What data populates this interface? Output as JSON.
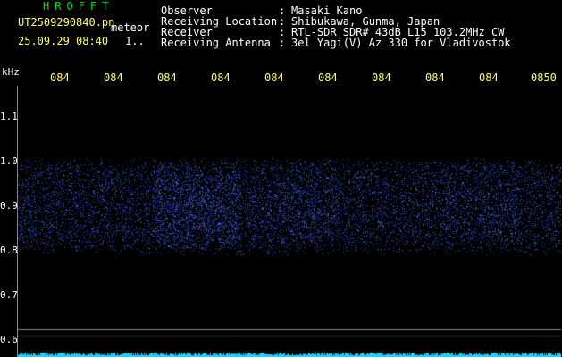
{
  "header": {
    "brand": "HROFFT",
    "filename": "UT2509290840.pn",
    "mode": "meteor",
    "datetime": "25.09.29 08:40",
    "count": "1..",
    "info": [
      {
        "label": "Observer",
        "value": "Masaki Kano"
      },
      {
        "label": "Receiving Location",
        "value": "Shibukawa, Gunma, Japan"
      },
      {
        "label": "Receiver",
        "value": "RTL-SDR SDR# 43dB L15 103.2MHz CW"
      },
      {
        "label": "Receiving Antenna",
        "value": "3el Yagi(V) Az 330 for Vladivostok"
      }
    ]
  },
  "axes": {
    "y_unit": "kHz",
    "y_ticks": [
      "1.1",
      "1.0",
      "0.9",
      "0.8",
      "0.7",
      "0.6"
    ],
    "x_ticks": [
      "084",
      "084",
      "084",
      "084",
      "084",
      "084",
      "084",
      "084",
      "084",
      "0850"
    ]
  },
  "colors": {
    "background": "#000000",
    "signal": "#3a4dff",
    "grid": "#8a8a8a",
    "baseline": "#19d4ff",
    "label_yellow": "#ffff66",
    "brand_green": "#00e000"
  }
}
